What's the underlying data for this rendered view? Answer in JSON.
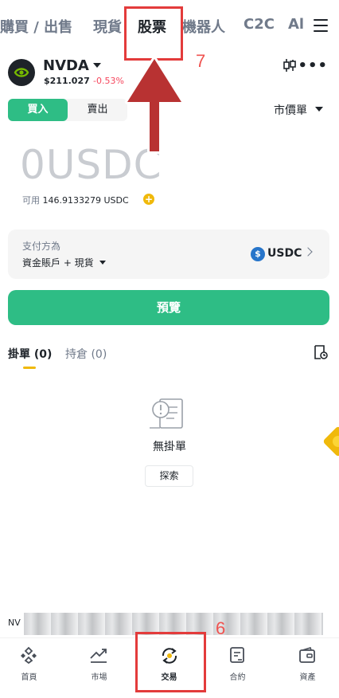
{
  "topnav": {
    "tabs": [
      {
        "label": "購買 / 出售",
        "active": false
      },
      {
        "label": "現貨",
        "active": false
      },
      {
        "label": "股票",
        "active": true
      },
      {
        "label": "機器人",
        "active": false
      },
      {
        "label": "C2C",
        "active": false
      },
      {
        "label": "Al",
        "active": false
      }
    ],
    "menu_icon": "hamburger-icon"
  },
  "pair": {
    "symbol": "NVDA",
    "price": "$211.027",
    "change": "-0.53%",
    "logo_icon": "nvidia-logo-icon",
    "chart_icon": "candlestick-icon",
    "more_icon": "more-dots-icon"
  },
  "trade": {
    "buy_label": "買入",
    "sell_label": "賣出",
    "order_type": "市價單",
    "amount_value": "0",
    "amount_unit": "USDC",
    "available_label": "可用",
    "available_value": "146.9133279 USDC"
  },
  "payment": {
    "label": "支付方為",
    "source": "資金賬戶 + 現貨",
    "asset": "USDC"
  },
  "preview_label": "預覽",
  "orders": {
    "tabs": [
      {
        "label": "掛單 (0)",
        "active": true
      },
      {
        "label": "持倉 (0)",
        "active": false
      }
    ],
    "empty_text": "無掛單",
    "explore_label": "探索"
  },
  "ticker": {
    "label": "NV"
  },
  "bottom_nav": [
    {
      "label": "首頁",
      "icon": "home-icon"
    },
    {
      "label": "市場",
      "icon": "market-chart-icon"
    },
    {
      "label": "交易",
      "icon": "trade-icon",
      "active": true
    },
    {
      "label": "合約",
      "icon": "futures-icon"
    },
    {
      "label": "資產",
      "icon": "wallet-icon"
    }
  ],
  "annotations": {
    "step_7": "7",
    "step_6": "6"
  },
  "colors": {
    "buy_green": "#2ebd85",
    "down_red": "#f6465d",
    "accent_yellow": "#f0b90b",
    "annotation_red": "#e33b3b"
  }
}
